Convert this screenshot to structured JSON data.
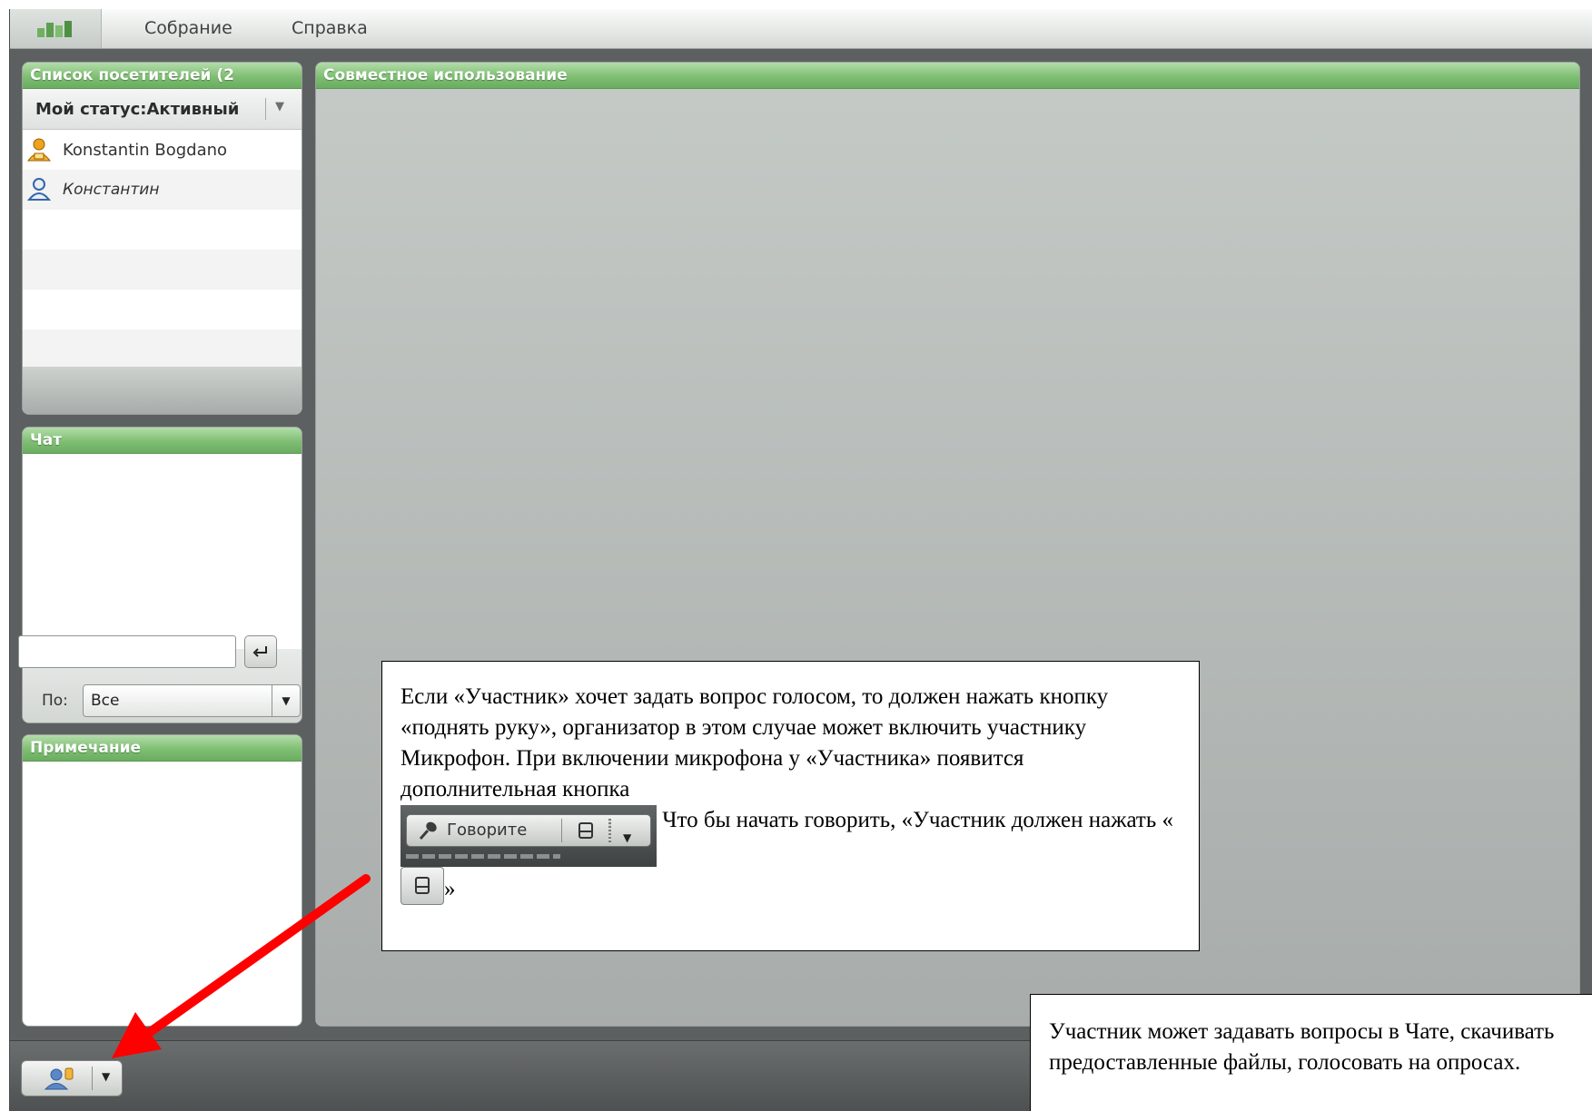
{
  "menu": {
    "items": [
      "Собрание",
      "Справка"
    ]
  },
  "attendees": {
    "title": "Список посетителей (2",
    "status_label": "Мой статус:",
    "status_value": "Активный",
    "people": [
      {
        "name": "Konstantin Bogdano",
        "role": "host",
        "icon": "host-user-icon"
      },
      {
        "name": "Константин",
        "role": "participant",
        "icon": "participant-user-icon"
      }
    ]
  },
  "share": {
    "title": "Совместное использование"
  },
  "chat": {
    "title": "Чат",
    "input_value": "",
    "to_label": "По:",
    "to_value": "Все"
  },
  "notes": {
    "title": "Примечание"
  },
  "callout_raise": {
    "text_1": "Если «Участник» хочет задать вопрос голосом, то должен нажать кнопку «поднять руку», организатор в этом случае может включить участнику Микрофон. При включении микрофона у «Участника» появится дополнительная кнопка",
    "talk_button_label": "Говорите",
    "text_2": " Что бы начать говорить, «Участник должен нажать « ",
    "text_3": "»"
  },
  "callout_chat": {
    "text": "Участник может задавать вопросы в Чате, скачивать предоставленные файлы, голосовать на опросах."
  },
  "colors": {
    "panel_header_green": "#7fbf73",
    "arrow_red": "#ff0000",
    "app_background": "#5d6060"
  }
}
